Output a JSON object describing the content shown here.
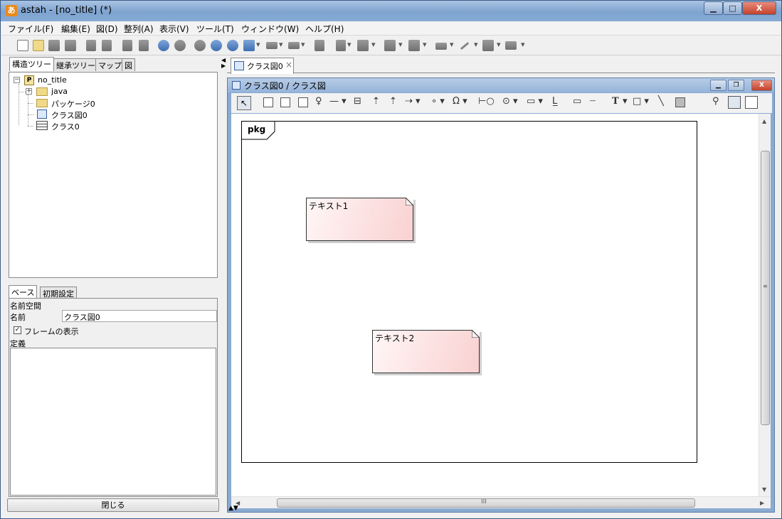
{
  "window": {
    "title": "astah - [no_title] (*)",
    "app_icon": "あ",
    "controls": {
      "minimize": "▁",
      "maximize": "□",
      "close": "X"
    }
  },
  "menubar": {
    "items": [
      "ファイル(F)",
      "編集(E)",
      "図(D)",
      "整列(A)",
      "表示(V)",
      "ツール(T)",
      "ウィンドウ(W)",
      "ヘルプ(H)"
    ]
  },
  "toolbar": {
    "icons": [
      "new-file-icon",
      "open-folder-icon",
      "save-icon",
      "print-icon",
      "copy-icon",
      "paste-icon",
      "copy2-icon",
      "delete-icon",
      "undo-icon",
      "redo-icon",
      "zoom-icon",
      "zoom-in-icon",
      "zoom-out-icon",
      "fit-icon",
      "back-icon",
      "forward-icon",
      "layout-icon",
      "align-top-icon",
      "align-left-icon",
      "fill-color-icon",
      "line-color-icon",
      "line-style-icon",
      "edge-icon",
      "tree-layout-icon",
      "distribute-icon"
    ]
  },
  "left_panel": {
    "tabs": [
      "構造ツリー",
      "継承ツリー",
      "マップ",
      "図"
    ],
    "tree": {
      "root": "no_title",
      "root_icon": "P",
      "children": [
        "java",
        "パッケージ0",
        "クラス図0",
        "クラス0"
      ]
    },
    "prop_tabs": [
      "ベース",
      "初期設定"
    ],
    "props": {
      "namespace_label": "名前空間",
      "name_label": "名前",
      "name_value": "クラス図0",
      "frame_checkbox_label": "フレームの表示",
      "frame_checked": "✓",
      "definition_label": "定義"
    },
    "close_button": "閉じる"
  },
  "editor": {
    "tab_label": "クラス図0",
    "tab_close": "×",
    "frame_title": "クラス図0 / クラス図",
    "inner_controls": {
      "minimize": "▁",
      "restore": "❐",
      "close": "X"
    },
    "frame_label": "pkg",
    "notes": [
      {
        "text": "テキスト1"
      },
      {
        "text": "テキスト2"
      }
    ],
    "toolbar_glyphs": {
      "select": "↖",
      "text_tool": "T",
      "hscroll_grip": "III",
      "vscroll_grip": "≡"
    }
  },
  "colors": {
    "note_fill": "#fde5e5",
    "titlebar": "#7ea3cf",
    "close": "#c3422b"
  }
}
